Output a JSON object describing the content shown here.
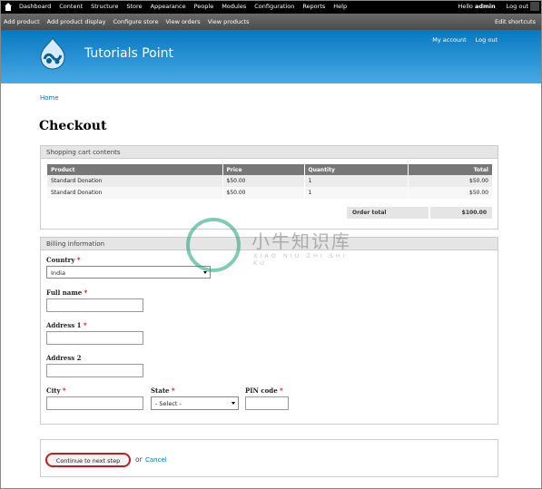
{
  "toolbar": {
    "items": [
      "Dashboard",
      "Content",
      "Structure",
      "Store",
      "Appearance",
      "People",
      "Modules",
      "Configuration",
      "Reports",
      "Help"
    ],
    "hello": "Hello",
    "user": "admin",
    "logout": "Log out"
  },
  "shortcuts": {
    "items": [
      "Add product",
      "Add product display",
      "Configure store",
      "View orders",
      "View products"
    ],
    "edit": "Edit shortcuts"
  },
  "header": {
    "site_name": "Tutorials Point",
    "my_account": "My account",
    "log_out": "Log out"
  },
  "breadcrumb": "Home",
  "page_title": "Checkout",
  "cart": {
    "legend": "Shopping cart contents",
    "columns": [
      "Product",
      "Price",
      "Quantity",
      "Total"
    ],
    "rows": [
      [
        "Standard Donation",
        "$50.00",
        "1",
        "$50.00"
      ],
      [
        "Standard Donation",
        "$50.00",
        "1",
        "$50.00"
      ]
    ],
    "order_total_label": "Order total",
    "order_total_value": "$100.00"
  },
  "billing": {
    "legend": "Billing information",
    "country_label": "Country",
    "country_value": "India",
    "full_name_label": "Full name",
    "address1_label": "Address 1",
    "address2_label": "Address 2",
    "city_label": "City",
    "state_label": "State",
    "state_value": "- Select -",
    "pin_label": "PIN code",
    "required_mark": "*"
  },
  "actions": {
    "continue": "Continue to next step",
    "or": "or",
    "cancel": "Cancel"
  },
  "watermark": {
    "text": "小牛知识库",
    "subtext": "XIAO NIU ZHI SHI KU"
  }
}
